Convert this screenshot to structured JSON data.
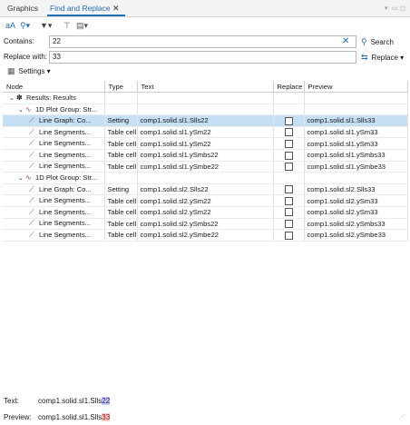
{
  "tabs": [
    {
      "label": "Graphics"
    },
    {
      "label": "Find and Replace"
    }
  ],
  "toolbar": {
    "case_label": "aA",
    "options_icon": "search-options-icon",
    "filter_icon": "filter-icon",
    "tree_icon": "tree-icon",
    "view_icon": "view-options-icon"
  },
  "form": {
    "contains_label": "Contains:",
    "contains_value": "22",
    "replace_label": "Replace with:",
    "replace_value": "33",
    "search_button": "Search",
    "replace_button": "Replace",
    "settings_label": "Settings"
  },
  "table": {
    "columns": [
      "Node",
      "Type",
      "Text",
      "Replace",
      "Preview"
    ],
    "rows": [
      {
        "level": 0,
        "icon": "results",
        "node": "Results: Results",
        "type": "",
        "text": "",
        "checkbox": false,
        "preview": "",
        "selected": false
      },
      {
        "level": 1,
        "icon": "plot",
        "node": "1D Plot Group: Str...",
        "type": "",
        "text": "",
        "checkbox": false,
        "preview": "",
        "selected": false
      },
      {
        "level": 2,
        "icon": "graph",
        "node": "Line Graph: Co...",
        "type": "Setting",
        "text": "comp1.solid.sl1.Slls22",
        "checkbox": true,
        "preview": "comp1.solid.sl1.Slls33",
        "selected": true
      },
      {
        "level": 2,
        "icon": "graph",
        "node": "Line Segments...",
        "type": "Table cell",
        "text": "comp1.solid.sl1.ySm22",
        "checkbox": true,
        "preview": "comp1.solid.sl1.ySm33",
        "selected": false
      },
      {
        "level": 2,
        "icon": "graph",
        "node": "Line Segments...",
        "type": "Table cell",
        "text": "comp1.solid.sl1.ySm22",
        "checkbox": true,
        "preview": "comp1.solid.sl1.ySm33",
        "selected": false
      },
      {
        "level": 2,
        "icon": "graph",
        "node": "Line Segments...",
        "type": "Table cell",
        "text": "comp1.solid.sl1.ySmbs22",
        "checkbox": true,
        "preview": "comp1.solid.sl1.ySmbs33",
        "selected": false
      },
      {
        "level": 2,
        "icon": "graph",
        "node": "Line Segments...",
        "type": "Table cell",
        "text": "comp1.solid.sl1.ySmbe22",
        "checkbox": true,
        "preview": "comp1.solid.sl1.ySmbe33",
        "selected": false
      },
      {
        "level": 1,
        "icon": "plot",
        "node": "1D Plot Group: Str...",
        "type": "",
        "text": "",
        "checkbox": false,
        "preview": "",
        "selected": false
      },
      {
        "level": 2,
        "icon": "graph",
        "node": "Line Graph: Co...",
        "type": "Setting",
        "text": "comp1.solid.sl2.Slls22",
        "checkbox": true,
        "preview": "comp1.solid.sl2.Slls33",
        "selected": false
      },
      {
        "level": 2,
        "icon": "graph",
        "node": "Line Segments...",
        "type": "Table cell",
        "text": "comp1.solid.sl2.ySm22",
        "checkbox": true,
        "preview": "comp1.solid.sl2.ySm33",
        "selected": false
      },
      {
        "level": 2,
        "icon": "graph",
        "node": "Line Segments...",
        "type": "Table cell",
        "text": "comp1.solid.sl2.ySm22",
        "checkbox": true,
        "preview": "comp1.solid.sl2.ySm33",
        "selected": false
      },
      {
        "level": 2,
        "icon": "graph",
        "node": "Line Segments...",
        "type": "Table cell",
        "text": "comp1.solid.sl2.ySmbs22",
        "checkbox": true,
        "preview": "comp1.solid.sl2.ySmbs33",
        "selected": false
      },
      {
        "level": 2,
        "icon": "graph",
        "node": "Line Segments...",
        "type": "Table cell",
        "text": "comp1.solid.sl2.ySmbe22",
        "checkbox": true,
        "preview": "comp1.solid.sl2.ySmbe33",
        "selected": false
      }
    ]
  },
  "footer": {
    "text_label": "Text:",
    "text_prefix": "comp1.solid.sl1.Slls",
    "text_match": "22",
    "preview_label": "Preview:",
    "preview_prefix": "comp1.solid.sl1.Slls",
    "preview_match": "33"
  },
  "colors": {
    "accent": "#1f6fb5",
    "selection": "#c5dff5",
    "match_highlight": "#c8c8f4",
    "replace_highlight": "#f4c8c8"
  }
}
